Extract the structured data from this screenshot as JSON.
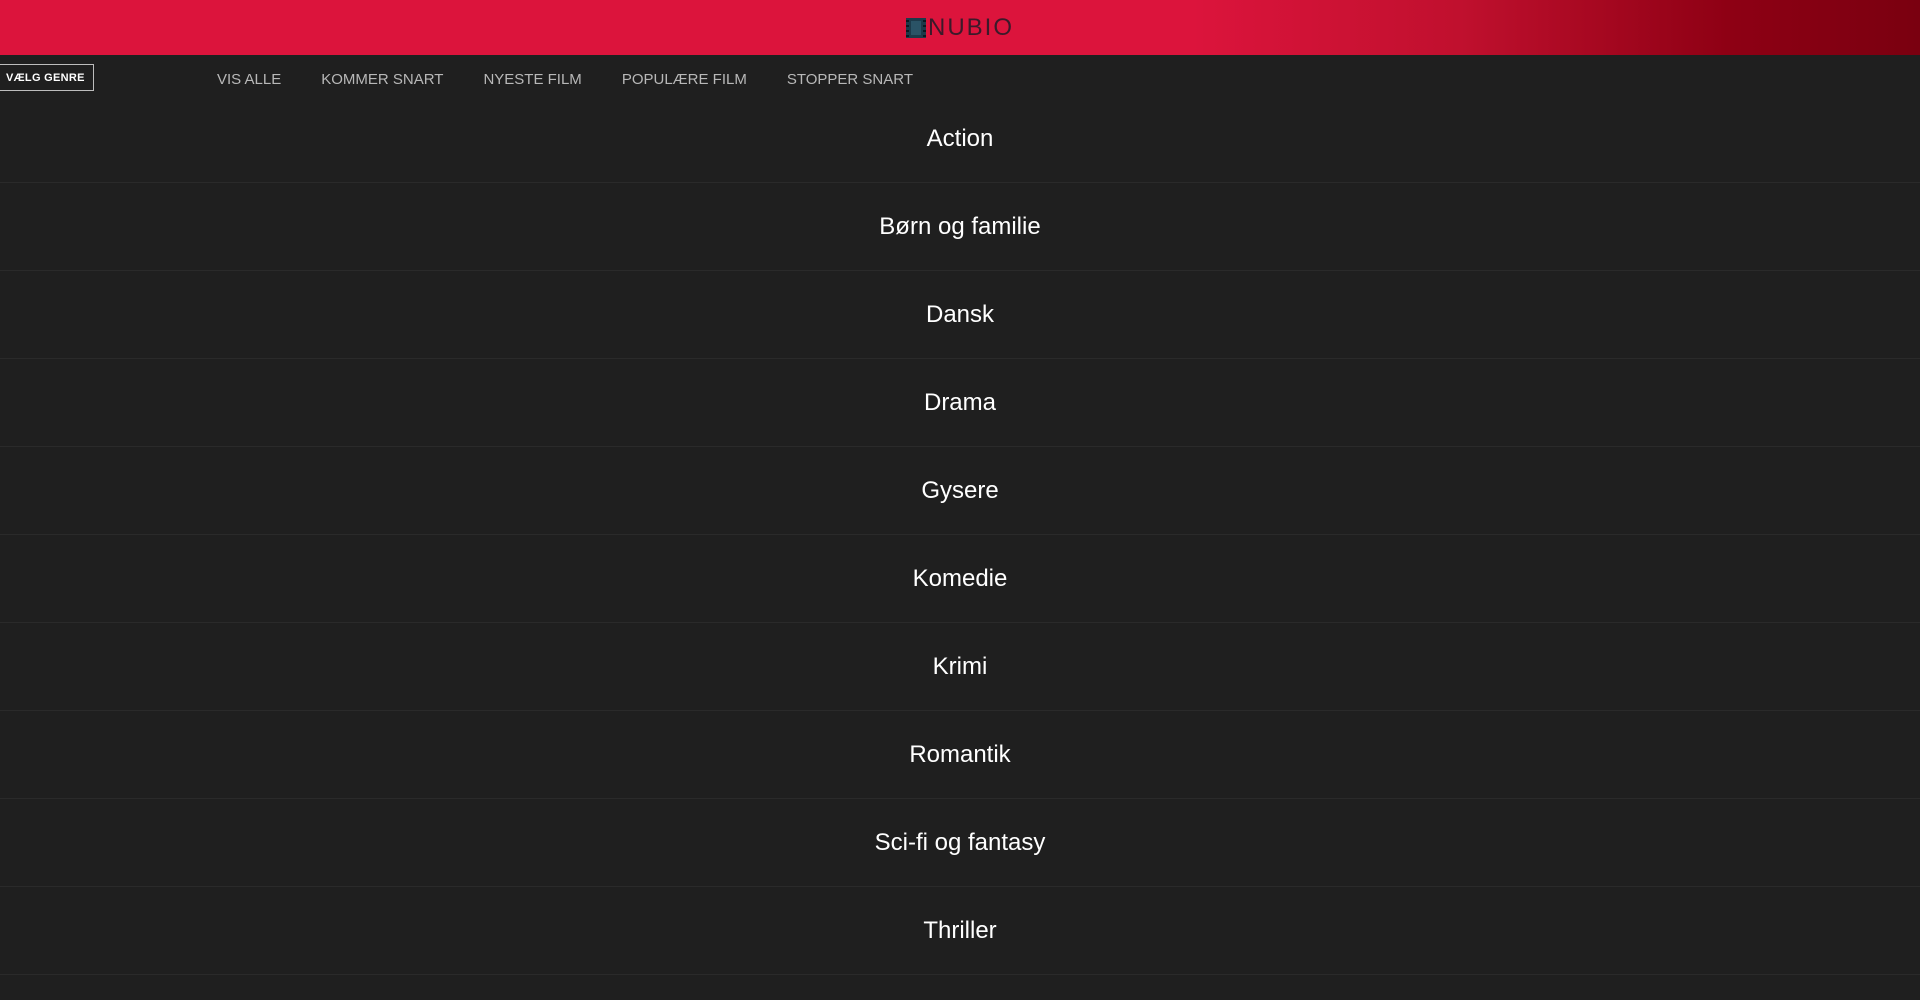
{
  "header": {
    "logo_text": "NUBIO",
    "logo_icon": "film-strip-icon",
    "colors": {
      "brand_red": "#dc143c",
      "brand_dark": "#7a0010",
      "background": "#1f1f1f"
    }
  },
  "nav": {
    "genre_button_label": "VÆLG GENRE",
    "links": [
      {
        "label": "VIS ALLE"
      },
      {
        "label": "KOMMER SNART"
      },
      {
        "label": "NYESTE FILM"
      },
      {
        "label": "POPULÆRE FILM"
      },
      {
        "label": "STOPPER SNART"
      }
    ]
  },
  "genres": [
    {
      "label": "Action"
    },
    {
      "label": "Børn og familie"
    },
    {
      "label": "Dansk"
    },
    {
      "label": "Drama"
    },
    {
      "label": "Gysere"
    },
    {
      "label": "Komedie"
    },
    {
      "label": "Krimi"
    },
    {
      "label": "Romantik"
    },
    {
      "label": "Sci-fi og fantasy"
    },
    {
      "label": "Thriller"
    }
  ]
}
